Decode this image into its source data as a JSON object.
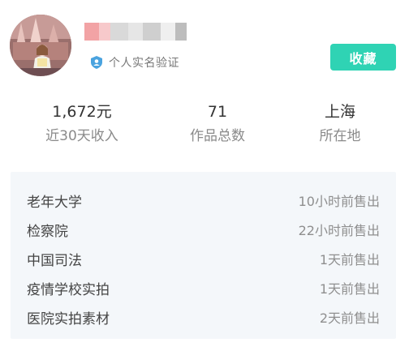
{
  "profile": {
    "verified_label": "个人实名验证",
    "favorite_button": "收藏",
    "name_mask_colors": [
      "#f2a3a5",
      "#f7c9cb",
      "#d9d9d9",
      "#e6e6e6",
      "#cfcfcf",
      "#efefef",
      "#bdbdbd"
    ]
  },
  "stats": [
    {
      "value": "1,672元",
      "label": "近30天收入"
    },
    {
      "value": "71",
      "label": "作品总数"
    },
    {
      "value": "上海",
      "label": "所在地"
    }
  ],
  "sales": [
    {
      "title": "老年大学",
      "time": "10小时前售出"
    },
    {
      "title": "检察院",
      "time": "22小时前售出"
    },
    {
      "title": "中国司法",
      "time": "1天前售出"
    },
    {
      "title": "疫情学校实拍",
      "time": "1天前售出"
    },
    {
      "title": "医院实拍素材",
      "time": "2天前售出"
    }
  ],
  "colors": {
    "accent": "#2fd3b4",
    "verify_icon": "#4aa3df",
    "list_background": "#f4f7fa"
  }
}
